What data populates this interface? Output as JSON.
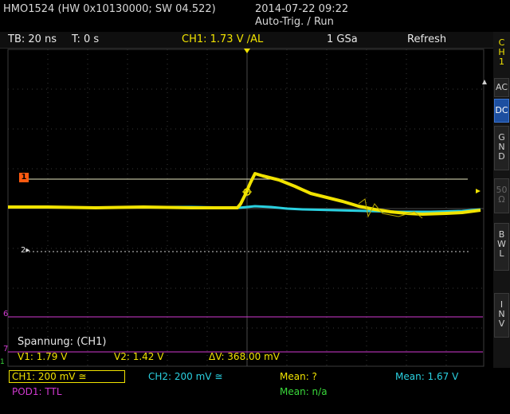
{
  "header": {
    "device_info": "HMO1524 (HW 0x10130000; SW 04.522)",
    "datetime": "2014-07-22 09:22",
    "trigger_status": "Auto-Trig. / Run"
  },
  "infobar": {
    "timebase": "TB: 20 ns",
    "trigger_time": "T: 0 s",
    "ch1_setting": "CH1: 1.73 V ∕AL",
    "sample_rate": "1 GSa",
    "mode": "Refresh"
  },
  "markers": {
    "ch1_marker": "1",
    "ch2_marker": "2",
    "pod_marker_6": "6",
    "pod_marker_7": "7",
    "pod_marker_1": "1"
  },
  "cursor_panel": {
    "title": "Spannung: (CH1)",
    "v1": "V1: 1.79 V",
    "v2": "V2: 1.42 V",
    "delta_v": "ΔV: 368.00 mV"
  },
  "sidebar": {
    "channel": [
      "C",
      "H",
      "1"
    ],
    "buttons": [
      {
        "label": "AC",
        "active": false
      },
      {
        "label": "DC",
        "active": true
      },
      {
        "label": "G N D",
        "active": false
      },
      {
        "label": "50 Ω",
        "active": false
      },
      {
        "label": "B W L",
        "active": false
      },
      {
        "label": "I N V",
        "active": false
      }
    ]
  },
  "bottom": {
    "ch1_scale": "CH1: 200 mV ≅",
    "ch2_scale": "CH2: 200 mV ≅",
    "mean_left": "Mean: ?",
    "mean_right": "Mean: 1.67 V",
    "pod": "POD1: TTL",
    "mean_na": "Mean: n/a"
  },
  "colors": {
    "ch1": "#f1e300",
    "ch2": "#2ad0e0",
    "pod": "#d23ad2",
    "green": "#39d83a",
    "orange": "#ff5a10"
  }
}
